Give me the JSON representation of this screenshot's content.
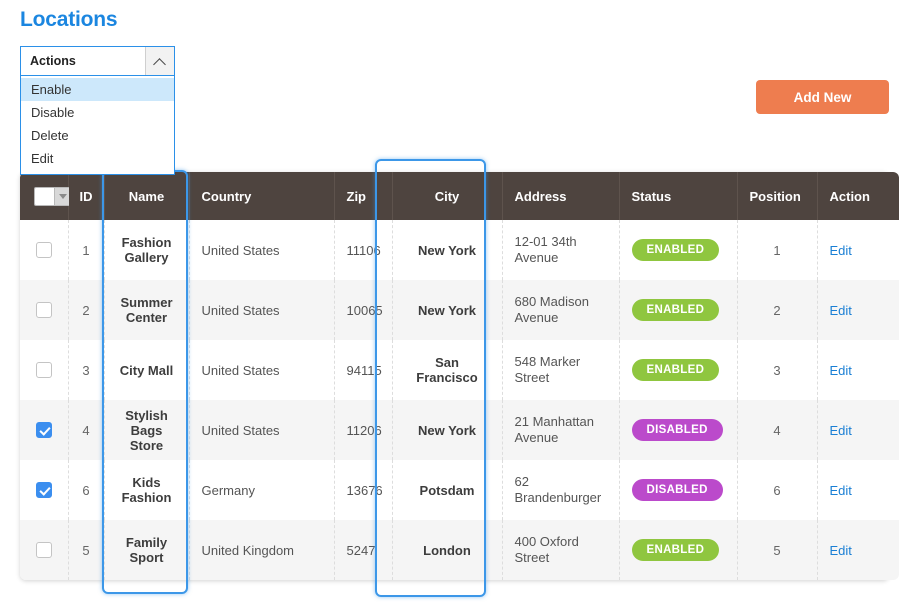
{
  "page": {
    "title": "Locations"
  },
  "actions_select": {
    "label": "Actions",
    "caret_icon": "chevron-up-icon",
    "expanded": true,
    "options": [
      "Enable",
      "Disable",
      "Delete",
      "Edit"
    ],
    "highlighted_option": "Enable"
  },
  "toolbar": {
    "add_new_label": "Add New",
    "add_new_color": "#ee7d4f"
  },
  "table": {
    "select_all_checked": false,
    "columns": [
      "",
      "ID",
      "Name",
      "Country",
      "Zip",
      "City",
      "Address",
      "Status",
      "Position",
      "Action"
    ],
    "highlighted_columns": [
      "Name",
      "City"
    ],
    "highlight_color": "#3c97e8",
    "header_bg": "#4e443f",
    "edit_label": "Edit",
    "rows": [
      {
        "checked": false,
        "id": "1",
        "name": "Fashion Gallery",
        "country": "United States",
        "zip": "11106",
        "city": "New York",
        "address": "12-01 34th Avenue",
        "status": "ENABLED",
        "position": "1",
        "action": "Edit"
      },
      {
        "checked": false,
        "id": "2",
        "name": "Summer Center",
        "country": "United States",
        "zip": "10065",
        "city": "New York",
        "address": "680 Madison Avenue",
        "status": "ENABLED",
        "position": "2",
        "action": "Edit"
      },
      {
        "checked": false,
        "id": "3",
        "name": "City Mall",
        "country": "United States",
        "zip": "94115",
        "city": "San Francisco",
        "address": "548 Marker Street",
        "status": "ENABLED",
        "position": "3",
        "action": "Edit"
      },
      {
        "checked": true,
        "id": "4",
        "name": "Stylish Bags Store",
        "country": "United States",
        "zip": "11206",
        "city": "New York",
        "address": "21 Manhattan Avenue",
        "status": "DISABLED",
        "position": "4",
        "action": "Edit"
      },
      {
        "checked": true,
        "id": "6",
        "name": "Kids Fashion",
        "country": "Germany",
        "zip": "13676",
        "city": "Potsdam",
        "address": "62 Brandenburger",
        "status": "DISABLED",
        "position": "6",
        "action": "Edit"
      },
      {
        "checked": false,
        "id": "5",
        "name": "Family Sport",
        "country": "United Kingdom",
        "zip": "5247",
        "city": "London",
        "address": "400 Oxford Street",
        "status": "ENABLED",
        "position": "5",
        "action": "Edit"
      }
    ]
  },
  "colors": {
    "enabled_badge": "#8fc63f",
    "disabled_badge": "#bb4acb",
    "link": "#1a7fd4",
    "title": "#1b86e0"
  }
}
